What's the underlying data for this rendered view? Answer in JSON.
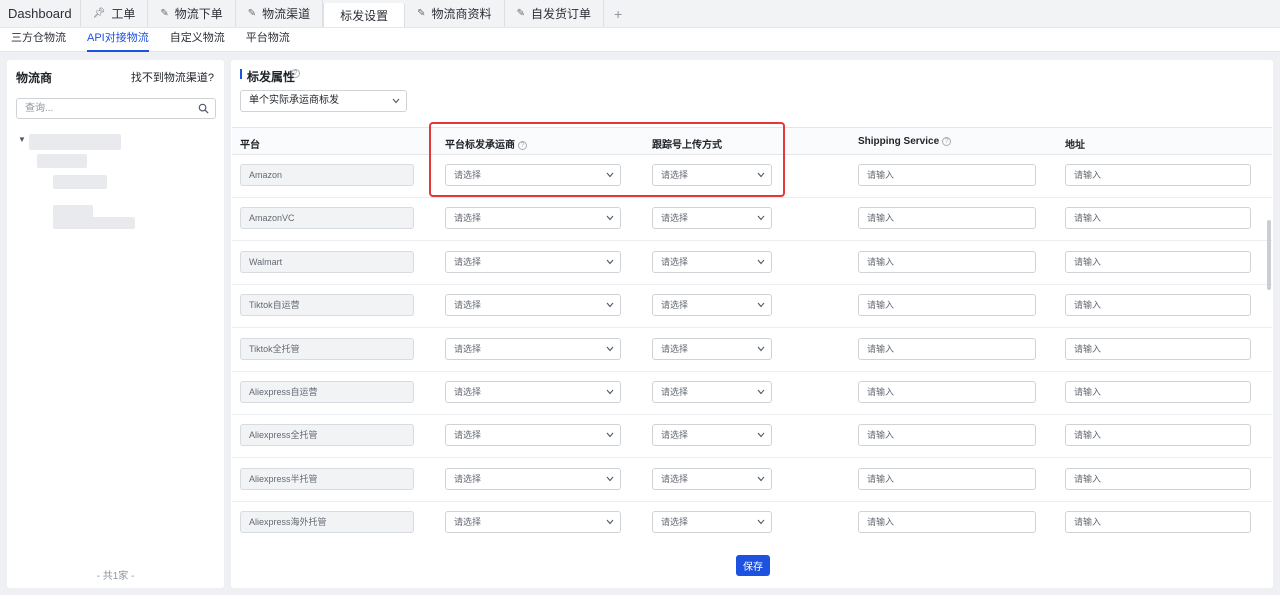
{
  "top_tabs": [
    {
      "label": "Dashboard",
      "pinned": false,
      "active": false
    },
    {
      "label": "工单",
      "pinned": true,
      "active": false
    },
    {
      "label": "物流下单",
      "pinned": false,
      "active": false
    },
    {
      "label": "物流渠道",
      "pinned": false,
      "active": false
    },
    {
      "label": "标发设置",
      "pinned": false,
      "active": true
    },
    {
      "label": "物流商资料",
      "pinned": false,
      "active": false
    },
    {
      "label": "自发货订单",
      "pinned": false,
      "active": false
    }
  ],
  "sub_tabs": [
    {
      "label": "三方仓物流",
      "active": false
    },
    {
      "label": "API对接物流",
      "active": true
    },
    {
      "label": "自定义物流",
      "active": false
    },
    {
      "label": "平台物流",
      "active": false
    }
  ],
  "left": {
    "title": "物流商",
    "link": "找不到物流渠道?",
    "search_placeholder": "查询...",
    "total": "- 共1家 -"
  },
  "section": {
    "title": "标发属性",
    "mode_select": "单个实际承运商标发"
  },
  "table": {
    "headers": {
      "platform": "平台",
      "carrier": "平台标发承运商",
      "tracking": "跟踪号上传方式",
      "service": "Shipping Service",
      "address": "地址"
    },
    "select_placeholder": "请选择",
    "input_placeholder": "请输入",
    "rows": [
      {
        "platform": "Amazon"
      },
      {
        "platform": "AmazonVC"
      },
      {
        "platform": "Walmart"
      },
      {
        "platform": "Tiktok自运营"
      },
      {
        "platform": "Tiktok全托管"
      },
      {
        "platform": "Aliexpress自运营"
      },
      {
        "platform": "Aliexpress全托管"
      },
      {
        "platform": "Aliexpress半托管"
      },
      {
        "platform": "Aliexpress海外托管"
      }
    ]
  },
  "save_label": "保存",
  "colors": {
    "accent": "#1d52e0",
    "highlight": "#e5373a"
  }
}
